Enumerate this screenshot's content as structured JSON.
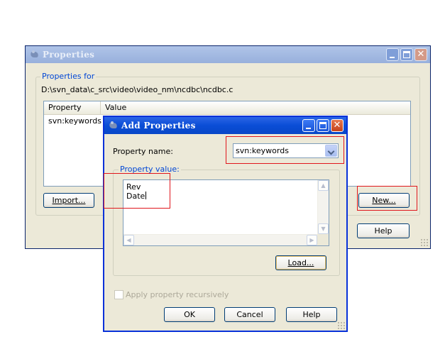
{
  "properties_dialog": {
    "title": "Properties",
    "group_label": "Properties for",
    "path": "D:\\svn_data\\c_src\\video\\video_nm\\ncdbc\\ncdbc.c",
    "columns": [
      "Property",
      "Value"
    ],
    "rows": [
      {
        "property": "svn:keywords",
        "value": ""
      }
    ],
    "import_button": "Import...",
    "new_button": "New...",
    "help_button": "Help"
  },
  "add_dialog": {
    "title": "Add Properties",
    "name_label": "Property name:",
    "name_value": "svn:keywords",
    "value_group_label": "Property value:",
    "value_lines": [
      "Rev",
      "Date"
    ],
    "load_button": "Load...",
    "recursive_label": "Apply property recursively",
    "recursive_checked": false,
    "ok_button": "OK",
    "cancel_button": "Cancel",
    "help_button": "Help"
  },
  "colors": {
    "active_titlebar": "#0a4dd6",
    "inactive_titlebar": "#98b0dc",
    "dialog_bg": "#ece9d8",
    "highlight": "#e0161c",
    "group_label": "#0046d5"
  },
  "icons": [
    "tortoise-app-icon",
    "minimize-icon",
    "maximize-icon",
    "close-icon",
    "chevron-down-icon",
    "scroll-up-icon",
    "scroll-down-icon",
    "scroll-left-icon",
    "scroll-right-icon",
    "resize-grip-icon"
  ]
}
